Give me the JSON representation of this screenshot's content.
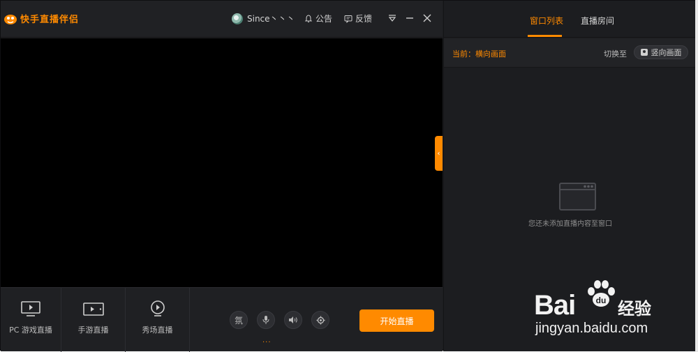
{
  "app": {
    "title": "快手直播伴侣",
    "user_name": "Since丶丶丶",
    "announcement_label": "公告",
    "feedback_label": "反馈"
  },
  "bottombar": {
    "modes": [
      {
        "label": "PC 游戏直播",
        "icon": "monitor-play-icon"
      },
      {
        "label": "手游直播",
        "icon": "tablet-play-icon"
      },
      {
        "label": "秀场直播",
        "icon": "webcam-icon"
      }
    ],
    "controls": [
      {
        "label": "氛",
        "icon": "ambience-icon"
      },
      {
        "label": "",
        "icon": "microphone-icon"
      },
      {
        "label": "",
        "icon": "speaker-icon"
      },
      {
        "label": "",
        "icon": "settings-icon"
      }
    ],
    "more_dots": "...",
    "start_label": "开始直播"
  },
  "right": {
    "tabs": [
      {
        "label": "窗口列表",
        "active": true
      },
      {
        "label": "直播房间",
        "active": false
      }
    ],
    "current_label": "当前：横向画面",
    "switch_label": "切换至",
    "switch_button": "竖向画面",
    "empty_text": "您还未添加直播内容至窗口"
  },
  "watermark": {
    "brand": "Bai",
    "brand2": "du",
    "sub": "经验",
    "url": "jingyan.baidu.com"
  },
  "colors": {
    "accent": "#ff8a00",
    "background": "#1f2023",
    "preview": "#000000"
  }
}
